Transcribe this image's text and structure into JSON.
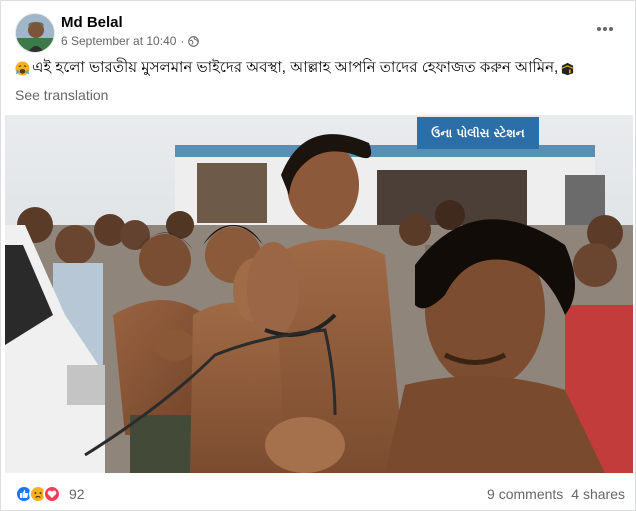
{
  "post": {
    "author": "Md Belal",
    "timestamp": "6 September at 10:40",
    "separator": "·",
    "privacy_icon": "globe-icon",
    "text": "এই হলো ভারতীয় মুসলমান ভাইদের অবস্থা, আল্লাহ আপনি তাদের হেফাজত করুন আমিন,",
    "leading_emoji": "weary-face-emoji",
    "trailing_emoji": "kaaba-emoji",
    "see_translation": "See translation"
  },
  "photo": {
    "sign_text": "ઉના પોલીસ સ્ટેશન"
  },
  "stats": {
    "reaction_icons": [
      "like-icon",
      "sad-icon",
      "love-icon"
    ],
    "reaction_count": "92",
    "comments": "9 comments",
    "shares": "4 shares"
  },
  "colors": {
    "like": "#1877f2",
    "sad": "#f7b125",
    "love": "#f33e58",
    "secondary_text": "#65676b"
  }
}
